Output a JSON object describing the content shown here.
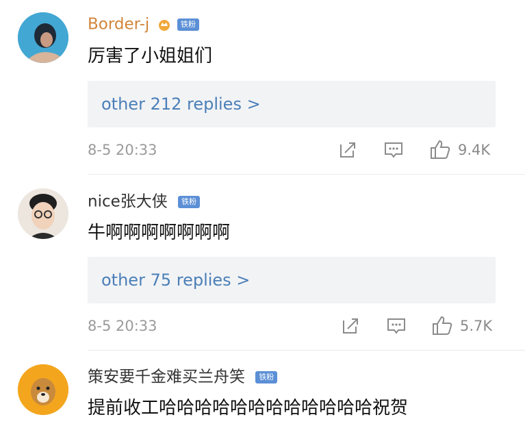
{
  "comments": [
    {
      "username": "Border-j",
      "badge": "铁粉",
      "text": "厉害了小姐姐们",
      "replies": "other 212 replies >",
      "time": "8-5 20:33",
      "likes": "9.4K"
    },
    {
      "username": "nice张大侠",
      "badge": "铁粉",
      "text": "牛啊啊啊啊啊啊啊",
      "replies": "other 75 replies >",
      "time": "8-5 20:33",
      "likes": "5.7K"
    },
    {
      "username": "策安要千金难买兰舟笑",
      "badge": "铁粉",
      "text": "提前收工哈哈哈哈哈哈哈哈哈哈哈哈祝贺"
    }
  ],
  "colors": {
    "username_vip": "#d2853a",
    "username": "#333333",
    "link": "#4a7fb8",
    "badge": "#5b8fd6"
  },
  "icons": [
    "share-icon",
    "comment-icon",
    "like-icon",
    "crown-icon"
  ]
}
